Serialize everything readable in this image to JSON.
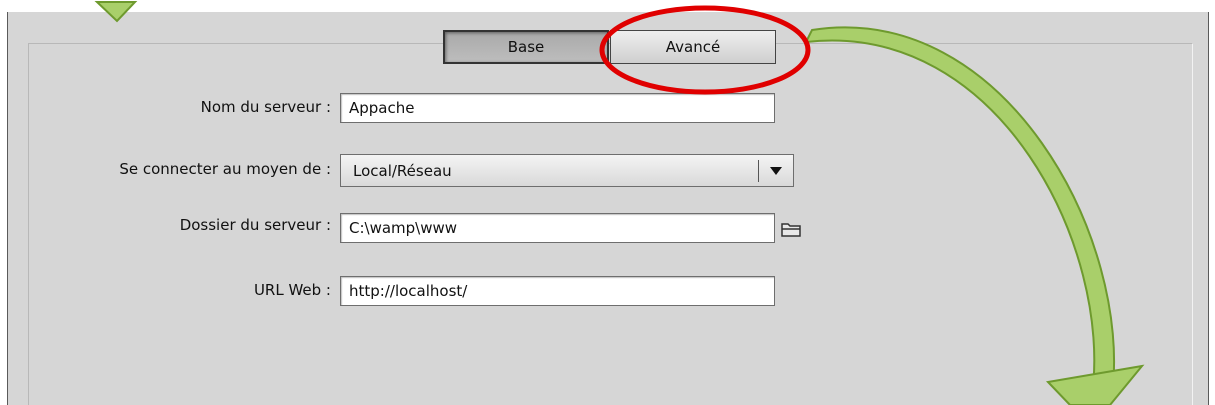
{
  "tabs": {
    "base_label": "Base",
    "advanced_label": "Avancé"
  },
  "form": {
    "server_name_label": "Nom du serveur :",
    "server_name_value": "Appache",
    "connect_label": "Se connecter au moyen de :",
    "connect_value": "Local/Réseau",
    "server_folder_label": "Dossier du serveur :",
    "server_folder_value": "C:\\wamp\\www",
    "web_url_label": "URL Web :",
    "web_url_value": "http://localhost/"
  },
  "icons": {
    "dropdown": "triangle-down-icon",
    "browse": "folder-icon"
  },
  "colors": {
    "dialog_background": "#d6d6d6",
    "annotation_circle": "#e00000",
    "annotation_arrow": "#a9cf6a"
  }
}
